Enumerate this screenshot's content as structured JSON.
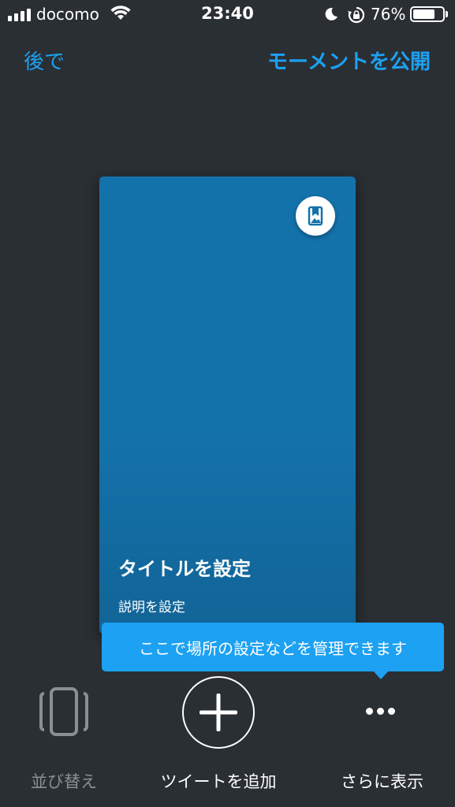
{
  "status_bar": {
    "carrier": "docomo",
    "time": "23:40",
    "battery_percent": "76%",
    "battery_level": 0.76,
    "icons": [
      "signal-icon",
      "wifi-icon",
      "moon-icon",
      "rotation-lock-icon",
      "battery-icon"
    ]
  },
  "nav": {
    "later_label": "後で",
    "publish_label": "モーメントを公開"
  },
  "card": {
    "title": "タイトルを設定",
    "description": "説明を設定",
    "icon": "bookmark-icon"
  },
  "tooltip": {
    "text": "ここで場所の設定などを管理できます"
  },
  "toolbar": {
    "reorder_label": "並び替え",
    "add_tweet_label": "ツイートを追加",
    "more_label": "さらに表示",
    "icons": [
      "reorder-icon",
      "plus-icon",
      "more-icon"
    ]
  },
  "colors": {
    "background": "#2a2f34",
    "accent": "#1da1f2",
    "card": "#1472ab",
    "dim_text": "#8a8f94"
  }
}
